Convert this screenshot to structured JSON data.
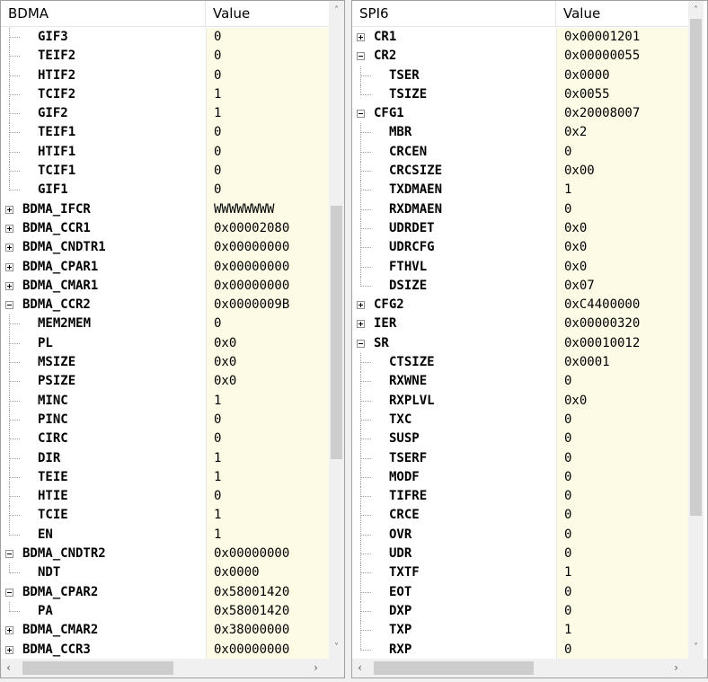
{
  "left_panel": {
    "col1": "BDMA",
    "col2": "Value",
    "rows": [
      {
        "name": "GIF3",
        "value": "0",
        "indent": 1,
        "last": false
      },
      {
        "name": "TEIF2",
        "value": "0",
        "indent": 1,
        "last": false
      },
      {
        "name": "HTIF2",
        "value": "0",
        "indent": 1,
        "last": false
      },
      {
        "name": "TCIF2",
        "value": "1",
        "indent": 1,
        "last": false
      },
      {
        "name": "GIF2",
        "value": "1",
        "indent": 1,
        "last": false
      },
      {
        "name": "TEIF1",
        "value": "0",
        "indent": 1,
        "last": false
      },
      {
        "name": "HTIF1",
        "value": "0",
        "indent": 1,
        "last": false
      },
      {
        "name": "TCIF1",
        "value": "0",
        "indent": 1,
        "last": false
      },
      {
        "name": "GIF1",
        "value": "0",
        "indent": 1,
        "last": true
      },
      {
        "name": "BDMA_IFCR",
        "value": "WWWWWWWW",
        "indent": 0,
        "expand": "plus"
      },
      {
        "name": "BDMA_CCR1",
        "value": "0x00002080",
        "indent": 0,
        "expand": "plus"
      },
      {
        "name": "BDMA_CNDTR1",
        "value": "0x00000000",
        "indent": 0,
        "expand": "plus"
      },
      {
        "name": "BDMA_CPAR1",
        "value": "0x00000000",
        "indent": 0,
        "expand": "plus"
      },
      {
        "name": "BDMA_CMAR1",
        "value": "0x00000000",
        "indent": 0,
        "expand": "plus"
      },
      {
        "name": "BDMA_CCR2",
        "value": "0x0000009B",
        "indent": 0,
        "expand": "minus"
      },
      {
        "name": "MEM2MEM",
        "value": "0",
        "indent": 1,
        "last": false
      },
      {
        "name": "PL",
        "value": "0x0",
        "indent": 1,
        "last": false
      },
      {
        "name": "MSIZE",
        "value": "0x0",
        "indent": 1,
        "last": false
      },
      {
        "name": "PSIZE",
        "value": "0x0",
        "indent": 1,
        "last": false
      },
      {
        "name": "MINC",
        "value": "1",
        "indent": 1,
        "last": false
      },
      {
        "name": "PINC",
        "value": "0",
        "indent": 1,
        "last": false
      },
      {
        "name": "CIRC",
        "value": "0",
        "indent": 1,
        "last": false
      },
      {
        "name": "DIR",
        "value": "1",
        "indent": 1,
        "last": false
      },
      {
        "name": "TEIE",
        "value": "1",
        "indent": 1,
        "last": false
      },
      {
        "name": "HTIE",
        "value": "0",
        "indent": 1,
        "last": false
      },
      {
        "name": "TCIE",
        "value": "1",
        "indent": 1,
        "last": false
      },
      {
        "name": "EN",
        "value": "1",
        "indent": 1,
        "last": true
      },
      {
        "name": "BDMA_CNDTR2",
        "value": "0x00000000",
        "indent": 0,
        "expand": "minus"
      },
      {
        "name": "NDT",
        "value": "0x0000",
        "indent": 1,
        "last": true
      },
      {
        "name": "BDMA_CPAR2",
        "value": "0x58001420",
        "indent": 0,
        "expand": "minus"
      },
      {
        "name": "PA",
        "value": "0x58001420",
        "indent": 1,
        "last": true
      },
      {
        "name": "BDMA_CMAR2",
        "value": "0x38000000",
        "indent": 0,
        "expand": "plus"
      },
      {
        "name": "BDMA_CCR3",
        "value": "0x00000000",
        "indent": 0,
        "expand": "plus"
      }
    ]
  },
  "right_panel": {
    "col1": "SPI6",
    "col2": "Value",
    "rows": [
      {
        "name": "CR1",
        "value": "0x00001201",
        "indent": 0,
        "expand": "plus"
      },
      {
        "name": "CR2",
        "value": "0x00000055",
        "indent": 0,
        "expand": "minus"
      },
      {
        "name": "TSER",
        "value": "0x0000",
        "indent": 1,
        "last": false
      },
      {
        "name": "TSIZE",
        "value": "0x0055",
        "indent": 1,
        "last": true
      },
      {
        "name": "CFG1",
        "value": "0x20008007",
        "indent": 0,
        "expand": "minus"
      },
      {
        "name": "MBR",
        "value": "0x2",
        "indent": 1,
        "last": false
      },
      {
        "name": "CRCEN",
        "value": "0",
        "indent": 1,
        "last": false
      },
      {
        "name": "CRCSIZE",
        "value": "0x00",
        "indent": 1,
        "last": false
      },
      {
        "name": "TXDMAEN",
        "value": "1",
        "indent": 1,
        "last": false
      },
      {
        "name": "RXDMAEN",
        "value": "0",
        "indent": 1,
        "last": false
      },
      {
        "name": "UDRDET",
        "value": "0x0",
        "indent": 1,
        "last": false
      },
      {
        "name": "UDRCFG",
        "value": "0x0",
        "indent": 1,
        "last": false
      },
      {
        "name": "FTHVL",
        "value": "0x0",
        "indent": 1,
        "last": false
      },
      {
        "name": "DSIZE",
        "value": "0x07",
        "indent": 1,
        "last": true
      },
      {
        "name": "CFG2",
        "value": "0xC4400000",
        "indent": 0,
        "expand": "plus"
      },
      {
        "name": "IER",
        "value": "0x00000320",
        "indent": 0,
        "expand": "plus"
      },
      {
        "name": "SR",
        "value": "0x00010012",
        "indent": 0,
        "expand": "minus"
      },
      {
        "name": "CTSIZE",
        "value": "0x0001",
        "indent": 1,
        "last": false
      },
      {
        "name": "RXWNE",
        "value": "0",
        "indent": 1,
        "last": false
      },
      {
        "name": "RXPLVL",
        "value": "0x0",
        "indent": 1,
        "last": false
      },
      {
        "name": "TXC",
        "value": "0",
        "indent": 1,
        "last": false
      },
      {
        "name": "SUSP",
        "value": "0",
        "indent": 1,
        "last": false
      },
      {
        "name": "TSERF",
        "value": "0",
        "indent": 1,
        "last": false
      },
      {
        "name": "MODF",
        "value": "0",
        "indent": 1,
        "last": false
      },
      {
        "name": "TIFRE",
        "value": "0",
        "indent": 1,
        "last": false
      },
      {
        "name": "CRCE",
        "value": "0",
        "indent": 1,
        "last": false
      },
      {
        "name": "OVR",
        "value": "0",
        "indent": 1,
        "last": false
      },
      {
        "name": "UDR",
        "value": "0",
        "indent": 1,
        "last": false
      },
      {
        "name": "TXTF",
        "value": "1",
        "indent": 1,
        "last": false
      },
      {
        "name": "EOT",
        "value": "0",
        "indent": 1,
        "last": false
      },
      {
        "name": "DXP",
        "value": "0",
        "indent": 1,
        "last": false
      },
      {
        "name": "TXP",
        "value": "1",
        "indent": 1,
        "last": false
      },
      {
        "name": "RXP",
        "value": "0",
        "indent": 1,
        "last": true
      }
    ]
  },
  "scroll_icons": {
    "up": "˄",
    "down": "˅",
    "left": "‹",
    "right": "›"
  }
}
